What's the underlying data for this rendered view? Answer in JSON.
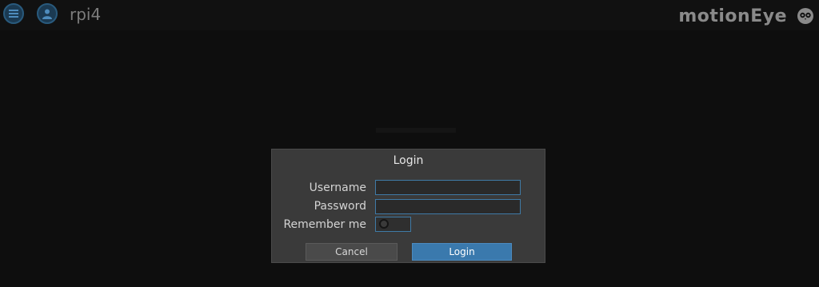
{
  "header": {
    "camera_name": "rpi4",
    "brand": "motionEye"
  },
  "icons": {
    "menu": "hamburger-menu-icon",
    "user": "user-icon",
    "logo": "owl-logo-icon"
  },
  "dialog": {
    "title": "Login",
    "fields": {
      "username_label": "Username",
      "username_value": "",
      "password_label": "Password",
      "password_value": "",
      "remember_label": "Remember me",
      "remember_checked": false
    },
    "buttons": {
      "cancel": "Cancel",
      "login": "Login"
    }
  },
  "colors": {
    "background": "#0e0e0e",
    "dialog": "#3a3a3a",
    "accent": "#3a79ad"
  }
}
